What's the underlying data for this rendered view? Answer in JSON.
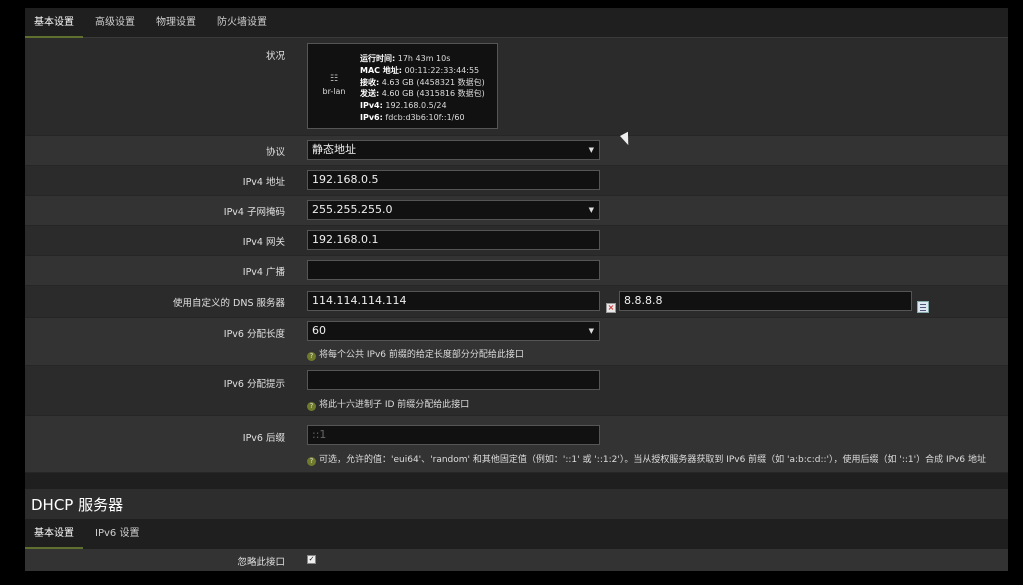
{
  "tabs": [
    "基本设置",
    "高级设置",
    "物理设置",
    "防火墙设置"
  ],
  "status": {
    "label": "状况",
    "iface_name": "br-lan",
    "lines": [
      {
        "k": "运行时间:",
        "v": "17h 43m 10s"
      },
      {
        "k": "MAC 地址:",
        "v": "00:11:22:33:44:55"
      },
      {
        "k": "接收:",
        "v": "4.63 GB (4458321 数据包)"
      },
      {
        "k": "发送:",
        "v": "4.60 GB (4315816 数据包)"
      },
      {
        "k": "IPv4:",
        "v": "192.168.0.5/24"
      },
      {
        "k": "IPv6:",
        "v": "fdcb:d3b6:10f::1/60"
      }
    ]
  },
  "fields": {
    "protocol": {
      "label": "协议",
      "value": "静态地址"
    },
    "ipv4_addr": {
      "label": "IPv4 地址",
      "value": "192.168.0.5"
    },
    "ipv4_mask": {
      "label": "IPv4 子网掩码",
      "value": "255.255.255.0"
    },
    "ipv4_gw": {
      "label": "IPv4 网关",
      "value": "192.168.0.1"
    },
    "ipv4_bcast": {
      "label": "IPv4 广播",
      "value": ""
    },
    "dns": {
      "label": "使用自定义的 DNS 服务器",
      "value1": "114.114.114.114",
      "value2": "8.8.8.8"
    },
    "ipv6_len": {
      "label": "IPv6 分配长度",
      "value": "60",
      "hint": "将每个公共 IPv6 前缀的给定长度部分分配给此接口"
    },
    "ipv6_hint": {
      "label": "IPv6 分配提示",
      "value": "",
      "hint": "将此十六进制子 ID 前缀分配给此接口"
    },
    "ipv6_suffix": {
      "label": "IPv6 后缀",
      "placeholder": "::1",
      "hint": "可选，允许的值：'eui64'、'random' 和其他固定值（例如：'::1' 或 '::1:2'）。当从授权服务器获取到 IPv6 前缀（如 'a:b:c:d::'），使用后缀（如 '::1'）合成 IPv6 地址"
    }
  },
  "dhcp": {
    "title": "DHCP 服务器",
    "tabs": [
      "基本设置",
      "IPv6 设置"
    ],
    "ignore_label": "忽略此接口",
    "ignore_checked": true
  }
}
